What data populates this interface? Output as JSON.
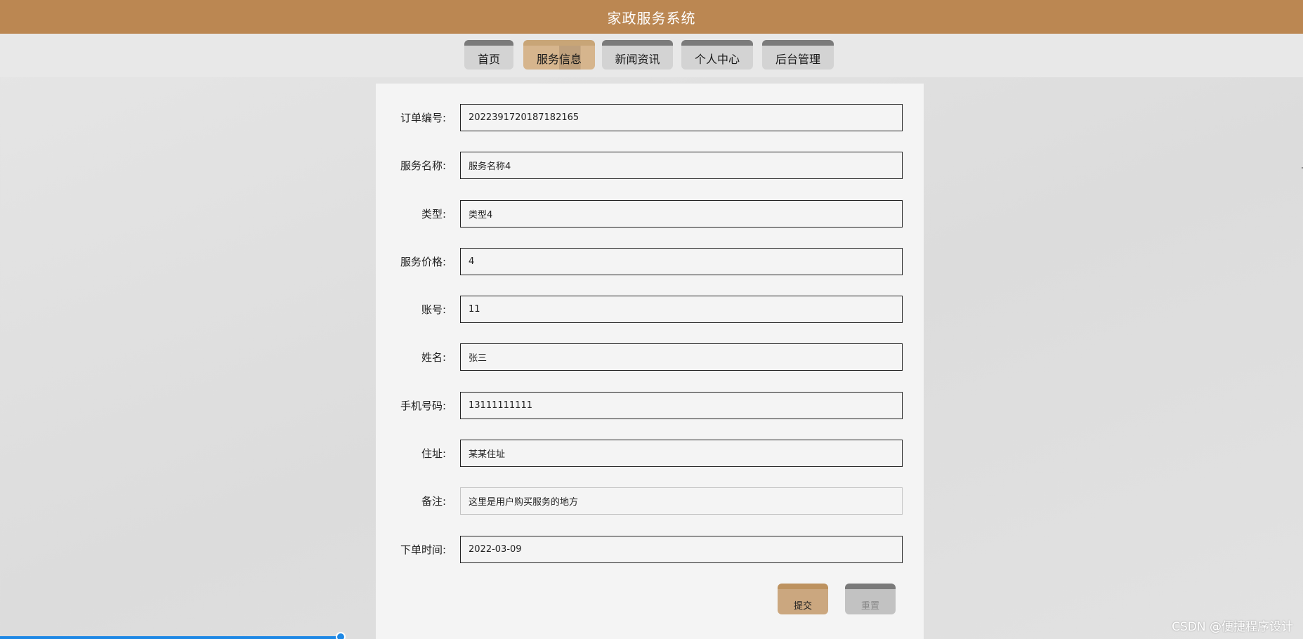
{
  "app": {
    "title": "家政服务系统"
  },
  "nav": {
    "items": [
      {
        "label": "首页"
      },
      {
        "label": "服务信息",
        "active": true
      },
      {
        "label": "新闻资讯"
      },
      {
        "label": "个人中心"
      },
      {
        "label": "后台管理"
      }
    ]
  },
  "form": {
    "fields": [
      {
        "label": "订单编号:",
        "value": "2022391720187182165"
      },
      {
        "label": "服务名称:",
        "value": "服务名称4"
      },
      {
        "label": "类型:",
        "value": "类型4"
      },
      {
        "label": "服务价格:",
        "value": "4"
      },
      {
        "label": "账号:",
        "value": "11"
      },
      {
        "label": "姓名:",
        "value": "张三"
      },
      {
        "label": "手机号码:",
        "value": "13111111111"
      },
      {
        "label": "住址:",
        "value": "某某住址"
      },
      {
        "label": "备注:",
        "value": "这里是用户购买服务的地方"
      },
      {
        "label": "下单时间:",
        "value": "2022-03-09"
      }
    ],
    "submit_label": "提交",
    "reset_label": "重置"
  },
  "watermark": "CSDN @便捷程序设计",
  "colors": {
    "header": "#bb8752",
    "accent": "#cba77f",
    "panel": "#f4f4f4"
  }
}
